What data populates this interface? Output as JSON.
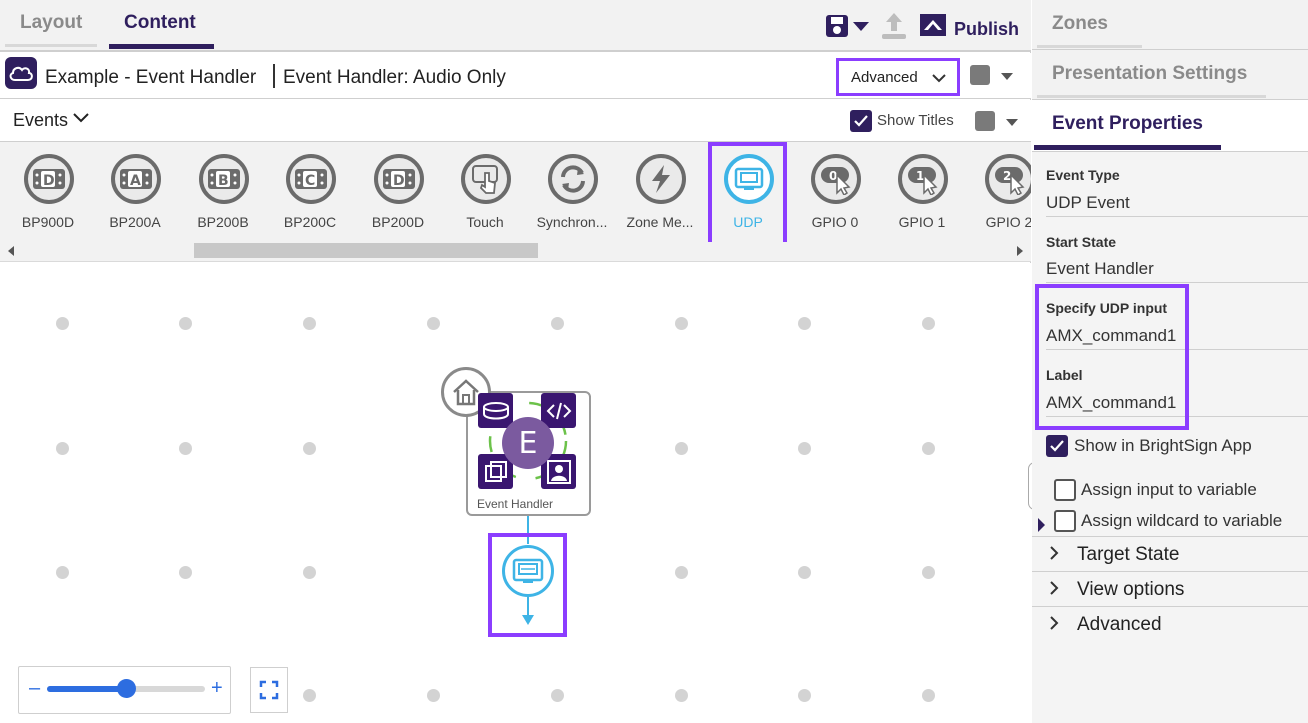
{
  "top_tabs": {
    "layout": "Layout",
    "content": "Content"
  },
  "toolbar": {
    "publish": "Publish",
    "save_icon": "save-icon",
    "upload_icon": "upload-icon",
    "publish_icon": "publish-icon"
  },
  "title_bar": {
    "presentation_name": "Example - Event Handler",
    "state_name": "Event Handler: Audio Only",
    "mode_select": "Advanced"
  },
  "events_bar": {
    "label": "Events",
    "show_titles": "Show Titles",
    "show_titles_checked": true
  },
  "palette": {
    "items": [
      {
        "label": "BP900D",
        "glyph": "D"
      },
      {
        "label": "BP200A",
        "glyph": "A"
      },
      {
        "label": "BP200B",
        "glyph": "B"
      },
      {
        "label": "BP200C",
        "glyph": "C"
      },
      {
        "label": "BP200D",
        "glyph": "D"
      },
      {
        "label": "Touch",
        "glyph": "touch"
      },
      {
        "label": "Synchron...",
        "glyph": "sync"
      },
      {
        "label": "Zone Me...",
        "glyph": "bolt"
      },
      {
        "label": "UDP",
        "glyph": "udp",
        "selected": true
      },
      {
        "label": "GPIO 0",
        "glyph": "0"
      },
      {
        "label": "GPIO 1",
        "glyph": "1"
      },
      {
        "label": "GPIO 2",
        "glyph": "2"
      }
    ]
  },
  "canvas": {
    "state_node_label": "Event Handler",
    "state_node_letter": "E",
    "zoom_level": 0.5
  },
  "right_tabs": {
    "zones": "Zones",
    "presentation_settings": "Presentation Settings",
    "event_properties": "Event Properties"
  },
  "properties": {
    "event_type_label": "Event Type",
    "event_type_value": "UDP Event",
    "start_state_label": "Start State",
    "start_state_value": "Event Handler",
    "udp_input_label": "Specify UDP input",
    "udp_input_value": "AMX_command1",
    "label_label": "Label",
    "label_value": "AMX_command1",
    "show_in_app": "Show in BrightSign App",
    "show_in_app_checked": true,
    "assign_input": "Assign input to variable",
    "assign_input_checked": false,
    "assign_wildcard": "Assign wildcard to variable",
    "assign_wildcard_checked": false,
    "sections": [
      "Target State",
      "View options",
      "Advanced"
    ]
  },
  "colors": {
    "brand": "#2f1f5e",
    "highlight": "#8b3dff",
    "udp_blue": "#3eb4e6",
    "zoom_blue": "#2d6de0"
  }
}
